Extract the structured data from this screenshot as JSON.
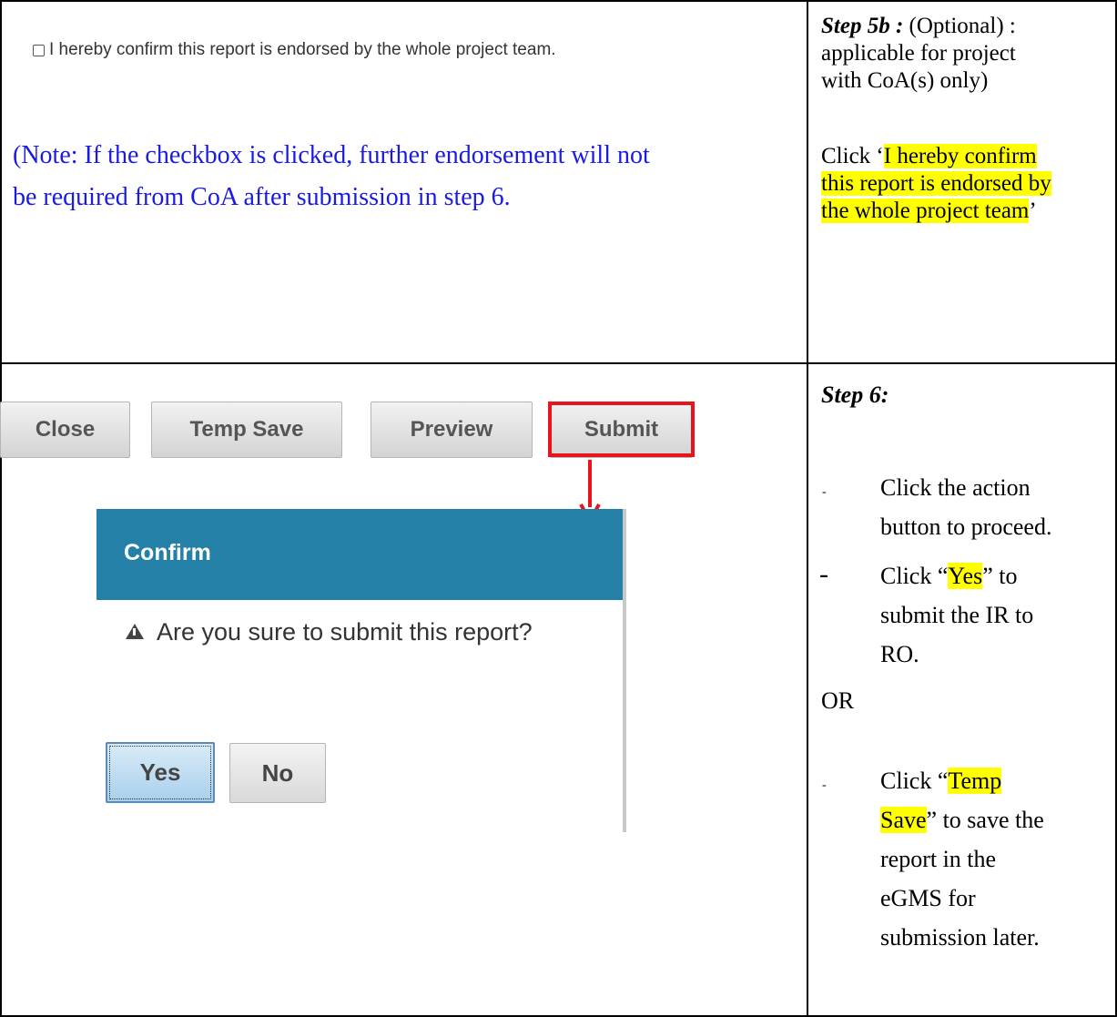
{
  "row1": {
    "checkbox_label": "I hereby confirm this report is endorsed by the whole project team.",
    "note_line1": "(Note: If the checkbox is clicked, further endorsement will not",
    "note_line2": "be required from CoA after submission in step 6.",
    "step_title": "Step 5b :",
    "step_optional": " (Optional) :",
    "step_line2": "applicable for project",
    "step_line3": "with CoA(s) only)",
    "click_prefix": "Click ‘",
    "click_hl1": "I hereby confirm",
    "click_hl2": "this report is endorsed by",
    "click_hl3": "the whole project team",
    "click_suffix": "’"
  },
  "row2": {
    "buttons": {
      "close": "Close",
      "temp_save": "Temp Save",
      "preview": "Preview",
      "submit": "Submit"
    },
    "dialog": {
      "title": "Confirm",
      "message": "Are you sure to submit this report?",
      "yes": "Yes",
      "no": "No"
    },
    "step_title": "Step 6:",
    "bullet_small": "-",
    "bullet_big": "-",
    "item1_line1": "Click the action",
    "item1_line2": "button to proceed.",
    "item2_prefix": "Click “",
    "item2_hl": "Yes",
    "item2_suffix": "” to",
    "item2_line2": "submit the IR to",
    "item2_line3": "RO.",
    "or": "OR",
    "item3_prefix": "Click “",
    "item3_hl1": "Temp",
    "item3_hl2": "Save",
    "item3_suffix": "” to save the",
    "item3_line3": "report in the",
    "item3_line4": "eGMS for",
    "item3_line5": "submission later."
  },
  "colors": {
    "note": "#1a1ae6",
    "highlight": "#ffff00",
    "dialog_header": "#2580a8",
    "submit_outline": "#e8141b"
  }
}
